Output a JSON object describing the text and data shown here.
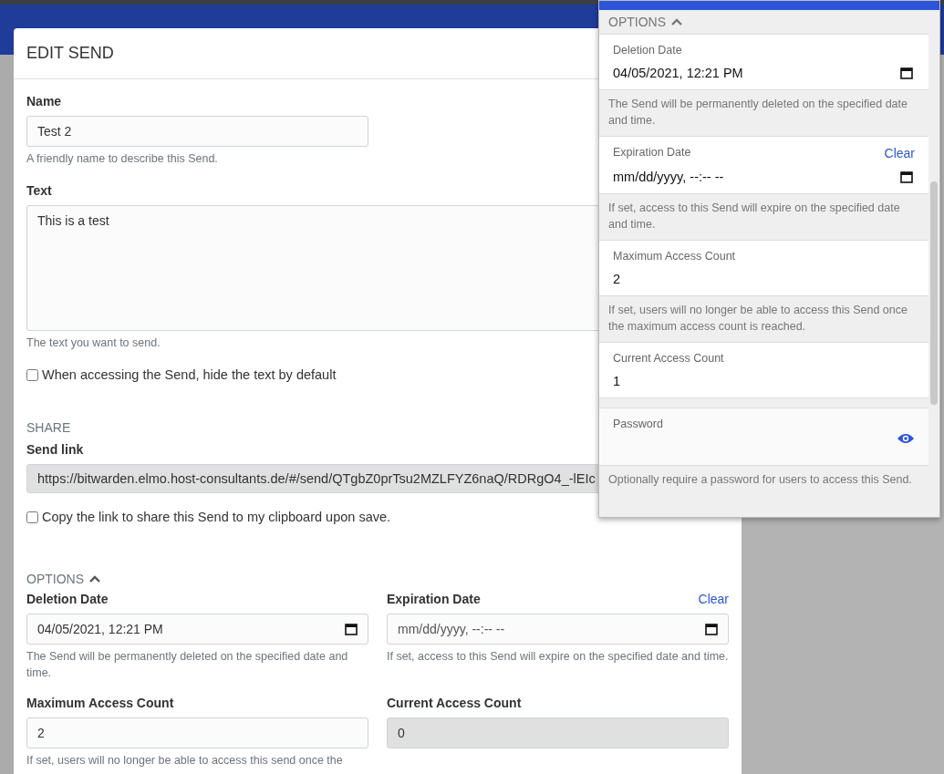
{
  "dialog": {
    "title": "EDIT SEND",
    "name": {
      "label": "Name",
      "value": "Test 2",
      "hint": "A friendly name to describe this Send."
    },
    "text": {
      "label": "Text",
      "value": "This is a test",
      "hint": "The text you want to send."
    },
    "hide_text": {
      "label": "When accessing the Send, hide the text by default",
      "checked": false
    },
    "share": {
      "heading": "SHARE",
      "label": "Send link",
      "value": "https://bitwarden.elmo.host-consultants.de/#/send/QTgbZ0prTsu2MZLFYZ6naQ/RDRgO4_-lEIc",
      "copy": {
        "label": "Copy the link to share this Send to my clipboard upon save.",
        "checked": false
      }
    },
    "options": {
      "heading": "OPTIONS",
      "expanded": true,
      "fields": [
        {
          "kind": "date",
          "label": "Deletion Date",
          "value": "04/05/2021, 12:21 PM",
          "hint": "The Send will be permanently deleted on the specified date and time.",
          "disabled": false
        },
        {
          "kind": "date",
          "label": "Expiration Date",
          "action": "Clear",
          "placeholder": "mm/dd/yyyy, --:-- --",
          "hint": "If set, access to this Send will expire on the specified date and time.",
          "disabled": false
        },
        {
          "kind": "number",
          "label": "Maximum Access Count",
          "value": "2",
          "hint": "If set, users will no longer be able to access this send once the",
          "disabled": false
        },
        {
          "kind": "number",
          "label": "Current Access Count",
          "value": "0",
          "disabled": true
        }
      ]
    }
  },
  "popup": {
    "heading": "OPTIONS",
    "expanded": true,
    "rows": [
      {
        "kind": "date",
        "label": "Deletion Date",
        "value": "04/05/2021, 12:21 PM",
        "hint": "The Send will be permanently deleted on the specified date and time."
      },
      {
        "kind": "date",
        "label": "Expiration Date",
        "action": "Clear",
        "placeholder": "mm/dd/yyyy, --:-- --",
        "hint": "If set, access to this Send will expire on the specified date and time."
      },
      {
        "kind": "number",
        "label": "Maximum Access Count",
        "value": "2",
        "hint": "If set, users will no longer be able to access this Send once the maximum access count is reached."
      },
      {
        "kind": "number",
        "label": "Current Access Count",
        "value": "1"
      },
      {
        "kind": "password",
        "label": "Password",
        "hint": "Optionally require a password for users to access this Send."
      }
    ]
  }
}
